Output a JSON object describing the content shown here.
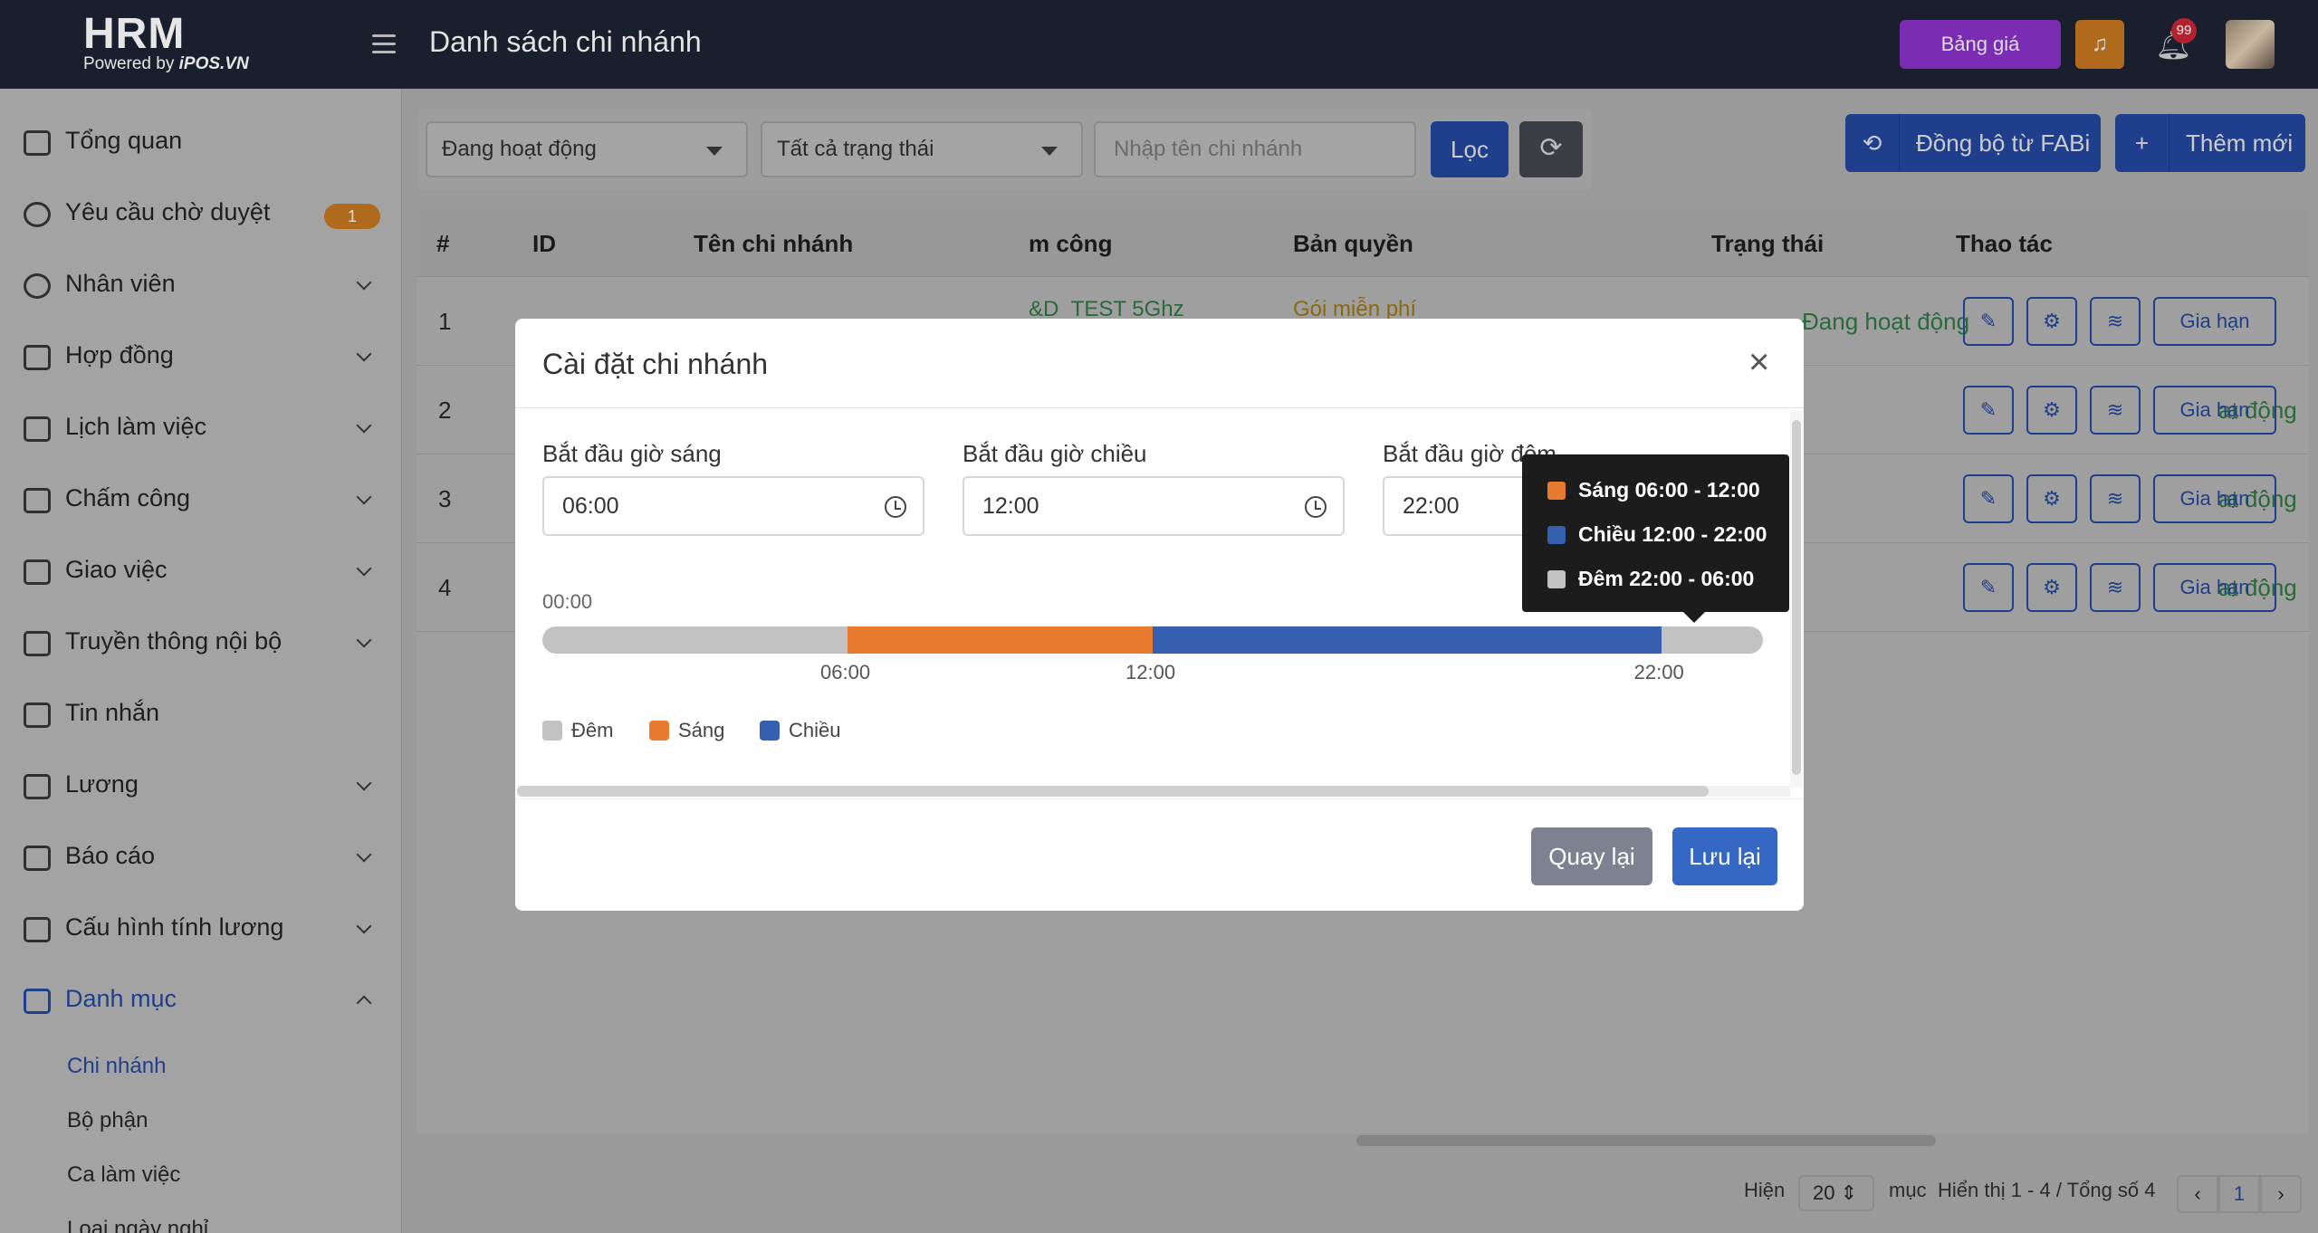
{
  "header": {
    "logo_main": "HRM",
    "logo_sub_prefix": "Powered by",
    "logo_sub_brand": "iPOS.VN",
    "title": "Danh sách chi nhánh",
    "price_button": "Bảng giá",
    "notification_count": "99"
  },
  "sidebar": {
    "items": [
      {
        "label": "Tổng quan"
      },
      {
        "label": "Yêu cầu chờ duyệt",
        "badge": "1"
      },
      {
        "label": "Nhân viên"
      },
      {
        "label": "Hợp đồng"
      },
      {
        "label": "Lịch làm việc"
      },
      {
        "label": "Chấm công"
      },
      {
        "label": "Giao việc"
      },
      {
        "label": "Truyền thông nội bộ"
      },
      {
        "label": "Tin nhắn"
      },
      {
        "label": "Lương"
      },
      {
        "label": "Báo cáo"
      },
      {
        "label": "Cấu hình tính lương"
      },
      {
        "label": "Danh mục"
      }
    ],
    "sub_items": [
      "Chi nhánh",
      "Bộ phận",
      "Ca làm việc",
      "Loại ngày nghỉ"
    ]
  },
  "filters": {
    "active_select": "Đang hoạt động",
    "status_select": "Tất cả trạng thái",
    "name_placeholder": "Nhập tên chi nhánh",
    "filter_button": "Lọc",
    "sync_button": "Đồng bộ từ FABi",
    "add_button": "Thêm mới"
  },
  "table": {
    "headers": [
      "#",
      "ID",
      "Tên chi nhánh",
      "m công",
      "Bản quyền",
      "Trạng thái",
      "Thao tác"
    ],
    "rows": [
      {
        "num": "1",
        "wifi": "&D_TEST 5Ghz",
        "license": "Gói miễn phí",
        "status": "Đang hoạt động"
      },
      {
        "num": "2",
        "status": "at động"
      },
      {
        "num": "3",
        "status": "at động"
      },
      {
        "num": "4",
        "status": "at động"
      }
    ],
    "renew_label": "Gia hạn"
  },
  "pagination": {
    "show_label": "Hiện",
    "page_size": "20",
    "items_label": "mục",
    "summary": "Hiển thị 1 - 4 / Tổng số 4",
    "current_page": "1"
  },
  "modal": {
    "title": "Cài đặt chi nhánh",
    "morning_label": "Bắt đầu giờ sáng",
    "morning_value": "06:00",
    "afternoon_label": "Bắt đầu giờ chiều",
    "afternoon_value": "12:00",
    "night_label": "Bắt đầu giờ đêm",
    "night_value": "22:00",
    "timeline_start": "00:00",
    "ticks": [
      "06:00",
      "12:00",
      "22:00"
    ],
    "legend": {
      "night": "Đêm",
      "morning": "Sáng",
      "afternoon": "Chiều"
    },
    "back_button": "Quay lại",
    "save_button": "Lưu lại",
    "tooltip": {
      "morning": "Sáng 06:00 - 12:00",
      "afternoon": "Chiều 12:00 - 22:00",
      "night": "Đêm 22:00 - 06:00"
    },
    "timeline_hours": {
      "morning_start": 6,
      "afternoon_start": 12,
      "night_start": 22,
      "total": 24
    }
  },
  "colors": {
    "morning": "#e87a30",
    "afternoon": "#3560b0",
    "night": "#c2c2c2",
    "primary": "#3567c4"
  }
}
